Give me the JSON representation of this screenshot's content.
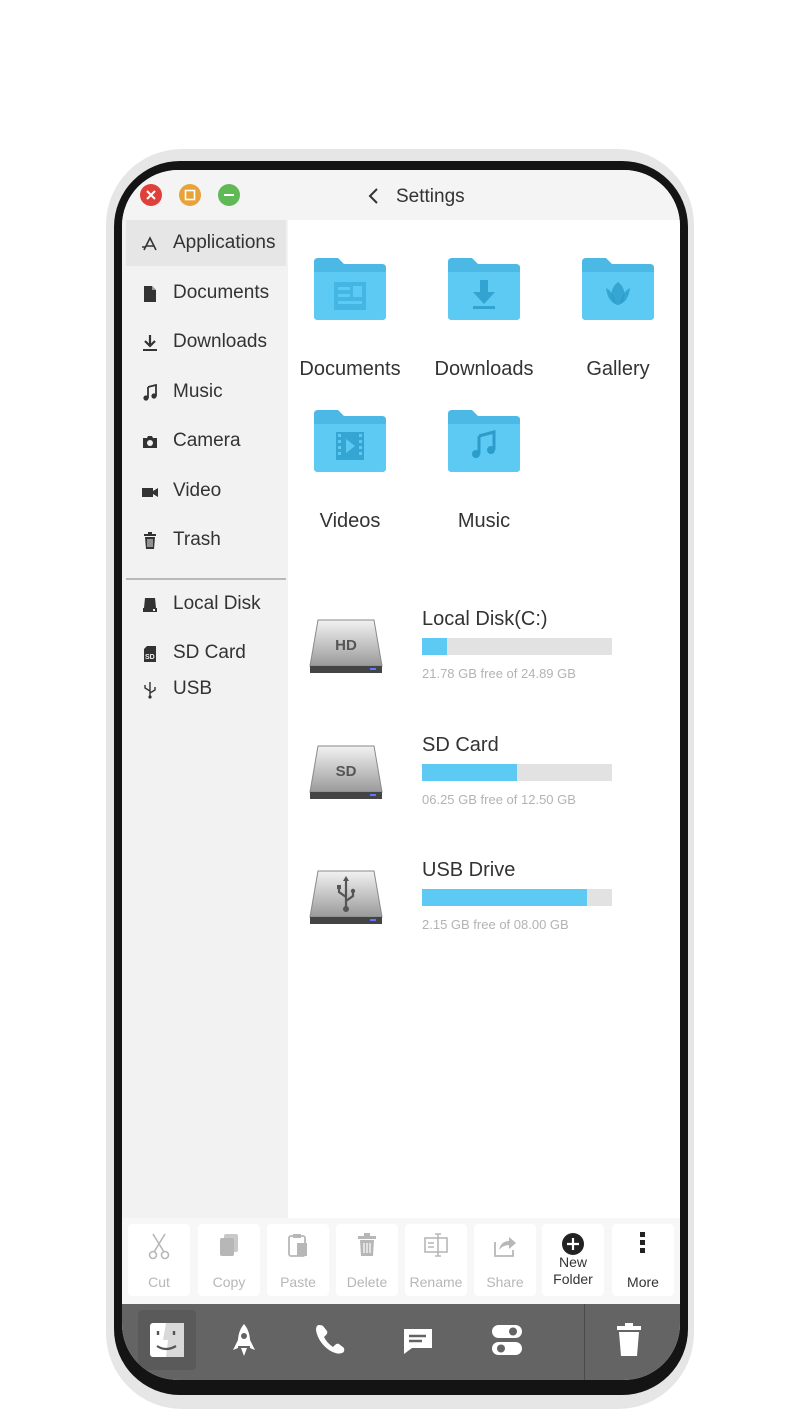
{
  "window": {
    "title": "Settings",
    "controls": [
      "close-icon",
      "maximize-icon",
      "minimize-icon"
    ],
    "colors": {
      "close": "#e0403a",
      "maximize": "#e7a23a",
      "minimize": "#5fb955"
    }
  },
  "sidebar": {
    "items": [
      {
        "label": "Applications",
        "icon": "applications-icon"
      },
      {
        "label": "Documents",
        "icon": "document-icon"
      },
      {
        "label": "Downloads",
        "icon": "download-icon"
      },
      {
        "label": "Music",
        "icon": "music-note-icon"
      },
      {
        "label": "Camera",
        "icon": "camera-icon"
      },
      {
        "label": "Video",
        "icon": "video-camera-icon"
      },
      {
        "label": "Trash",
        "icon": "trash-icon"
      }
    ],
    "devices": [
      {
        "label": "Local Disk",
        "icon": "hard-disk-icon"
      },
      {
        "label": "SD Card",
        "icon": "sd-card-icon"
      },
      {
        "label": "USB",
        "icon": "usb-icon"
      }
    ],
    "active_item": "Applications"
  },
  "folders": [
    {
      "label": "Documents",
      "icon": "documents-folder-icon"
    },
    {
      "label": "Downloads",
      "icon": "downloads-folder-icon"
    },
    {
      "label": "Gallery",
      "icon": "gallery-folder-icon"
    },
    {
      "label": "Videos",
      "icon": "videos-folder-icon"
    },
    {
      "label": "Music",
      "icon": "music-folder-icon"
    }
  ],
  "drives": [
    {
      "name": "Local Disk(C:)",
      "badge": "HD",
      "free_text": "21.78 GB free of 24.89 GB",
      "used_fraction": 0.13
    },
    {
      "name": "SD Card",
      "badge": "SD",
      "free_text": "06.25 GB free of 12.50 GB",
      "used_fraction": 0.5
    },
    {
      "name": "USB Drive",
      "badge": "usb-symbol-icon",
      "free_text": "2.15 GB free of 08.00 GB",
      "used_fraction": 0.87
    }
  ],
  "actions": [
    {
      "label": "Cut",
      "icon": "scissors-icon",
      "enabled": false
    },
    {
      "label": "Copy",
      "icon": "copy-icon",
      "enabled": false
    },
    {
      "label": "Paste",
      "icon": "paste-icon",
      "enabled": false
    },
    {
      "label": "Delete",
      "icon": "delete-icon",
      "enabled": false
    },
    {
      "label": "Rename",
      "icon": "rename-icon",
      "enabled": false
    },
    {
      "label": "Share",
      "icon": "share-icon",
      "enabled": false
    },
    {
      "label": "New\nFolder",
      "label_line1": "New",
      "label_line2": "Folder",
      "icon": "add-circle-icon",
      "enabled": true
    },
    {
      "label": "More",
      "icon": "more-vertical-icon",
      "enabled": true
    }
  ],
  "dock": {
    "items": [
      "finder-icon",
      "rocket-icon",
      "phone-icon",
      "message-icon",
      "toggle-settings-icon",
      "trash-icon"
    ],
    "active_item": "finder-icon"
  },
  "colors": {
    "folder_blue": "#5ccaf3",
    "progress_fill": "#5ccaf3",
    "progress_track": "#e2e2e2",
    "dock_bg": "#646464",
    "sidebar_bg": "#f2f2f2"
  }
}
